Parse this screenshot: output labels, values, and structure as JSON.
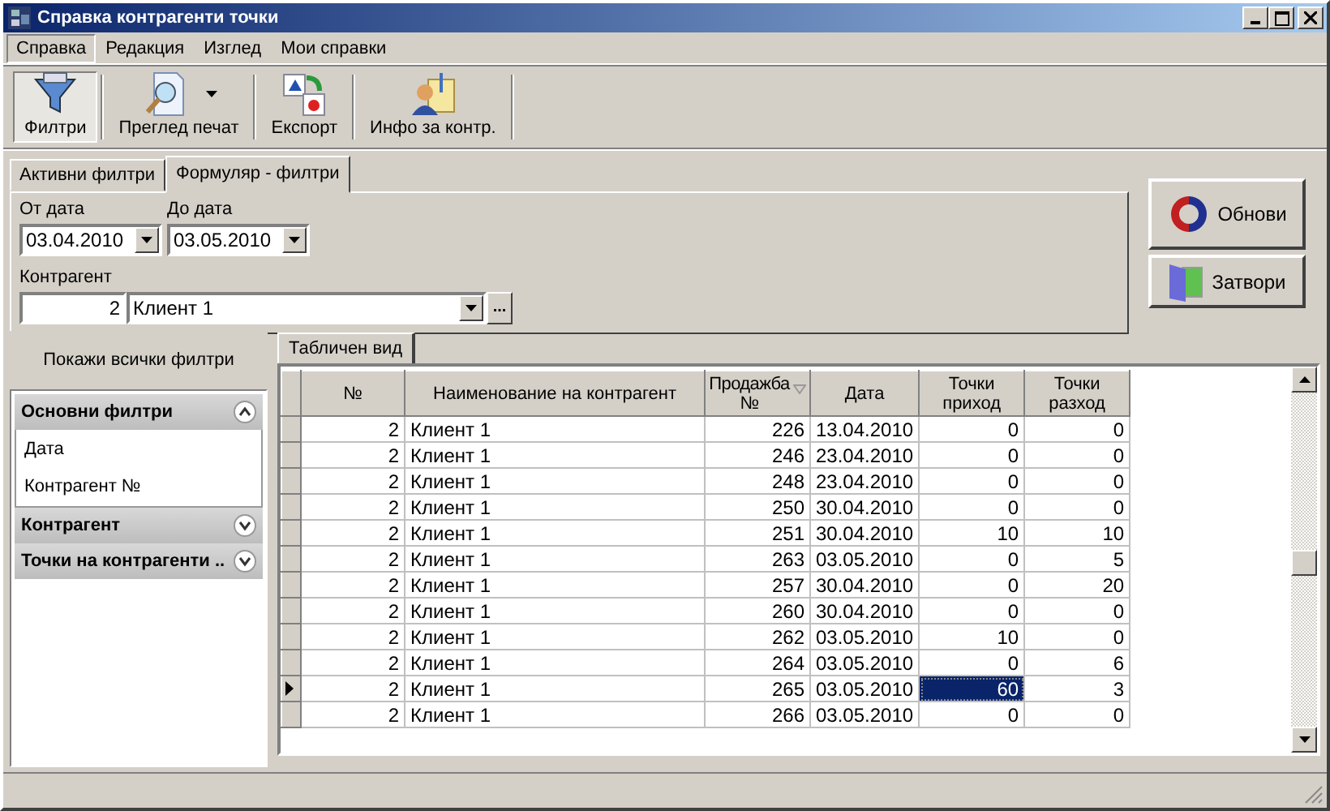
{
  "window": {
    "title": "Справка контрагенти точки"
  },
  "menu": [
    {
      "label": "Справка",
      "selected": true
    },
    {
      "label": "Редакция",
      "selected": false
    },
    {
      "label": "Изглед",
      "selected": false
    },
    {
      "label": "Мои справки",
      "selected": false
    }
  ],
  "toolbar": [
    {
      "label": "Филтри",
      "kind": "filter",
      "pressed": true,
      "dropdown": false
    },
    {
      "label": "Преглед печат",
      "kind": "preview",
      "pressed": false,
      "dropdown": true
    },
    {
      "label": "Експорт",
      "kind": "export",
      "pressed": false,
      "dropdown": false
    },
    {
      "label": "Инфо за контр.",
      "kind": "info",
      "pressed": false,
      "dropdown": false
    }
  ],
  "filter_tabs": [
    {
      "label": "Активни филтри",
      "selected": false
    },
    {
      "label": "Формуляр - филтри",
      "selected": true
    }
  ],
  "filters": {
    "from_label": "От дата",
    "from_value": "03.04.2010",
    "to_label": "До дата",
    "to_value": "03.05.2010",
    "contractor_label": "Контрагент",
    "contractor_code": "2",
    "contractor_name": "Клиент 1",
    "browse": "..."
  },
  "actions": [
    {
      "label": "Обнови",
      "kind": "refresh"
    },
    {
      "label": "Затвори",
      "kind": "close"
    }
  ],
  "sidebar": {
    "show_all": "Покажи всички филтри",
    "groups": [
      {
        "title": "Основни филтри",
        "expanded": true,
        "items": [
          "Дата",
          "Контрагент №"
        ]
      },
      {
        "title": "Контрагент",
        "expanded": false
      },
      {
        "title": "Точки на контрагенти ..",
        "expanded": false
      }
    ]
  },
  "table_tab": "Табличен вид",
  "columns": [
    {
      "label": "№",
      "sorted": false
    },
    {
      "label": "Наименование на контрагент",
      "sorted": false
    },
    {
      "label": "Продажба №",
      "sorted": true
    },
    {
      "label": "Дата",
      "sorted": false
    },
    {
      "label": "Точки приход",
      "sorted": false
    },
    {
      "label": "Точки разход",
      "sorted": false
    }
  ],
  "rows": [
    {
      "current": false,
      "cells": [
        {
          "text": "2",
          "selected": false
        },
        {
          "text": "Клиент 1",
          "selected": false
        },
        {
          "text": "226",
          "selected": false
        },
        {
          "text": "13.04.2010",
          "selected": false
        },
        {
          "text": "0",
          "selected": false
        },
        {
          "text": "0",
          "selected": false
        }
      ]
    },
    {
      "current": false,
      "cells": [
        {
          "text": "2",
          "selected": false
        },
        {
          "text": "Клиент 1",
          "selected": false
        },
        {
          "text": "246",
          "selected": false
        },
        {
          "text": "23.04.2010",
          "selected": false
        },
        {
          "text": "0",
          "selected": false
        },
        {
          "text": "0",
          "selected": false
        }
      ]
    },
    {
      "current": false,
      "cells": [
        {
          "text": "2",
          "selected": false
        },
        {
          "text": "Клиент 1",
          "selected": false
        },
        {
          "text": "248",
          "selected": false
        },
        {
          "text": "23.04.2010",
          "selected": false
        },
        {
          "text": "0",
          "selected": false
        },
        {
          "text": "0",
          "selected": false
        }
      ]
    },
    {
      "current": false,
      "cells": [
        {
          "text": "2",
          "selected": false
        },
        {
          "text": "Клиент 1",
          "selected": false
        },
        {
          "text": "250",
          "selected": false
        },
        {
          "text": "30.04.2010",
          "selected": false
        },
        {
          "text": "0",
          "selected": false
        },
        {
          "text": "0",
          "selected": false
        }
      ]
    },
    {
      "current": false,
      "cells": [
        {
          "text": "2",
          "selected": false
        },
        {
          "text": "Клиент 1",
          "selected": false
        },
        {
          "text": "251",
          "selected": false
        },
        {
          "text": "30.04.2010",
          "selected": false
        },
        {
          "text": "10",
          "selected": false
        },
        {
          "text": "10",
          "selected": false
        }
      ]
    },
    {
      "current": false,
      "cells": [
        {
          "text": "2",
          "selected": false
        },
        {
          "text": "Клиент 1",
          "selected": false
        },
        {
          "text": "263",
          "selected": false
        },
        {
          "text": "03.05.2010",
          "selected": false
        },
        {
          "text": "0",
          "selected": false
        },
        {
          "text": "5",
          "selected": false
        }
      ]
    },
    {
      "current": false,
      "cells": [
        {
          "text": "2",
          "selected": false
        },
        {
          "text": "Клиент 1",
          "selected": false
        },
        {
          "text": "257",
          "selected": false
        },
        {
          "text": "30.04.2010",
          "selected": false
        },
        {
          "text": "0",
          "selected": false
        },
        {
          "text": "20",
          "selected": false
        }
      ]
    },
    {
      "current": false,
      "cells": [
        {
          "text": "2",
          "selected": false
        },
        {
          "text": "Клиент 1",
          "selected": false
        },
        {
          "text": "260",
          "selected": false
        },
        {
          "text": "30.04.2010",
          "selected": false
        },
        {
          "text": "0",
          "selected": false
        },
        {
          "text": "0",
          "selected": false
        }
      ]
    },
    {
      "current": false,
      "cells": [
        {
          "text": "2",
          "selected": false
        },
        {
          "text": "Клиент 1",
          "selected": false
        },
        {
          "text": "262",
          "selected": false
        },
        {
          "text": "03.05.2010",
          "selected": false
        },
        {
          "text": "10",
          "selected": false
        },
        {
          "text": "0",
          "selected": false
        }
      ]
    },
    {
      "current": false,
      "cells": [
        {
          "text": "2",
          "selected": false
        },
        {
          "text": "Клиент 1",
          "selected": false
        },
        {
          "text": "264",
          "selected": false
        },
        {
          "text": "03.05.2010",
          "selected": false
        },
        {
          "text": "0",
          "selected": false
        },
        {
          "text": "6",
          "selected": false
        }
      ]
    },
    {
      "current": true,
      "cells": [
        {
          "text": "2",
          "selected": false
        },
        {
          "text": "Клиент 1",
          "selected": false
        },
        {
          "text": "265",
          "selected": false
        },
        {
          "text": "03.05.2010",
          "selected": false
        },
        {
          "text": "60",
          "selected": true
        },
        {
          "text": "3",
          "selected": false
        }
      ]
    },
    {
      "current": false,
      "cells": [
        {
          "text": "2",
          "selected": false
        },
        {
          "text": "Клиент 1",
          "selected": false
        },
        {
          "text": "266",
          "selected": false
        },
        {
          "text": "03.05.2010",
          "selected": false
        },
        {
          "text": "0",
          "selected": false
        },
        {
          "text": "0",
          "selected": false
        }
      ]
    }
  ]
}
